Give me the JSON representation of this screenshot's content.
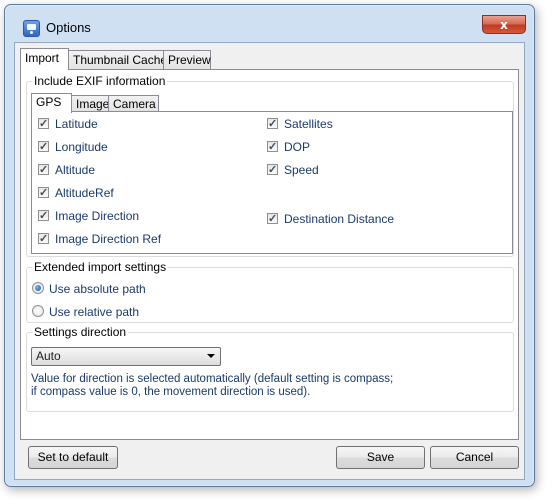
{
  "window": {
    "title": "Options",
    "close_glyph": "x"
  },
  "tabs": [
    "Import",
    "Thumbnail Cache",
    "Preview"
  ],
  "exif": {
    "legend": "Include EXIF information",
    "subtabs": [
      "GPS",
      "Image",
      "Camera"
    ],
    "left_items": [
      "Latitude",
      "Longitude",
      "Altitude",
      "AltitudeRef",
      "Image Direction",
      "Image Direction Ref"
    ],
    "right_items": [
      "Satellites",
      "DOP",
      "Speed",
      "Destination Distance"
    ]
  },
  "extended": {
    "legend": "Extended import settings",
    "options": [
      "Use absolute path",
      "Use relative path"
    ],
    "selected": "Use absolute path"
  },
  "direction": {
    "legend": "Settings direction",
    "dropdown_value": "Auto",
    "info_line1": "Value for direction is selected automatically (default setting is compass;",
    "info_line2": "if compass value is 0, the movement direction is used)."
  },
  "buttons": {
    "default": "Set to default",
    "save": "Save",
    "cancel": "Cancel"
  },
  "colors": {
    "label_text": "#1a3a6a",
    "window_frame": "#cfe0f3",
    "close_red": "#c03c22"
  }
}
